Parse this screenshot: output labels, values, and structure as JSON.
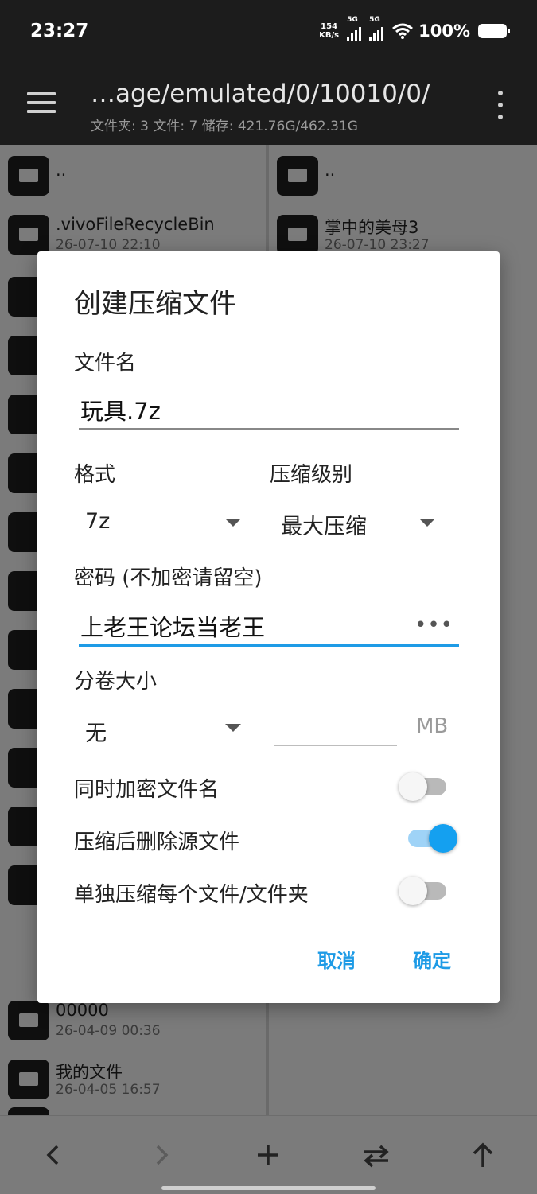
{
  "status_bar": {
    "time": "23:27",
    "net_speed_value": "154",
    "net_speed_unit": "KB/s",
    "sim1": "5G",
    "sim2": "5G",
    "battery": "100%"
  },
  "app_bar": {
    "path": "…age/emulated/0/10010/0/",
    "summary": "文件夹: 3  文件: 7  储存: 421.76G/462.31G"
  },
  "left_pane": {
    "items": [
      {
        "name": "..",
        "date": ""
      },
      {
        "name": ".vivoFileRecycleBin",
        "date": "26-07-10 22:10"
      }
    ],
    "bottom_items": [
      {
        "name": "00000",
        "date": "26-04-09 00:36"
      },
      {
        "name": "我的文件",
        "date": "26-04-05 16:57"
      }
    ]
  },
  "right_pane": {
    "items": [
      {
        "name": "..",
        "date": ""
      },
      {
        "name": "掌中的美母3",
        "date": "26-07-10 23:27"
      }
    ]
  },
  "dialog": {
    "title": "创建压缩文件",
    "filename_label": "文件名",
    "filename_value": "玩具.7z",
    "format_label": "格式",
    "format_value": "7z",
    "level_label": "压缩级别",
    "level_value": "最大压缩",
    "password_label": "密码 (不加密请留空)",
    "password_value": "上老王论坛当老王",
    "password_toggle": "•••",
    "split_label": "分卷大小",
    "split_value": "无",
    "split_unit": "MB",
    "toggles": [
      {
        "label": "同时加密文件名",
        "on": false
      },
      {
        "label": "压缩后删除源文件",
        "on": true
      },
      {
        "label": "单独压缩每个文件/文件夹",
        "on": false
      }
    ],
    "cancel": "取消",
    "ok": "确定"
  },
  "bottom_bar": {
    "icons": [
      "back-icon",
      "forward-icon",
      "add-icon",
      "swap-icon",
      "up-icon"
    ]
  },
  "colors": {
    "accent": "#1e9be6",
    "switch_on": "#14a0f0",
    "dark_bar": "#1c1c1c"
  }
}
